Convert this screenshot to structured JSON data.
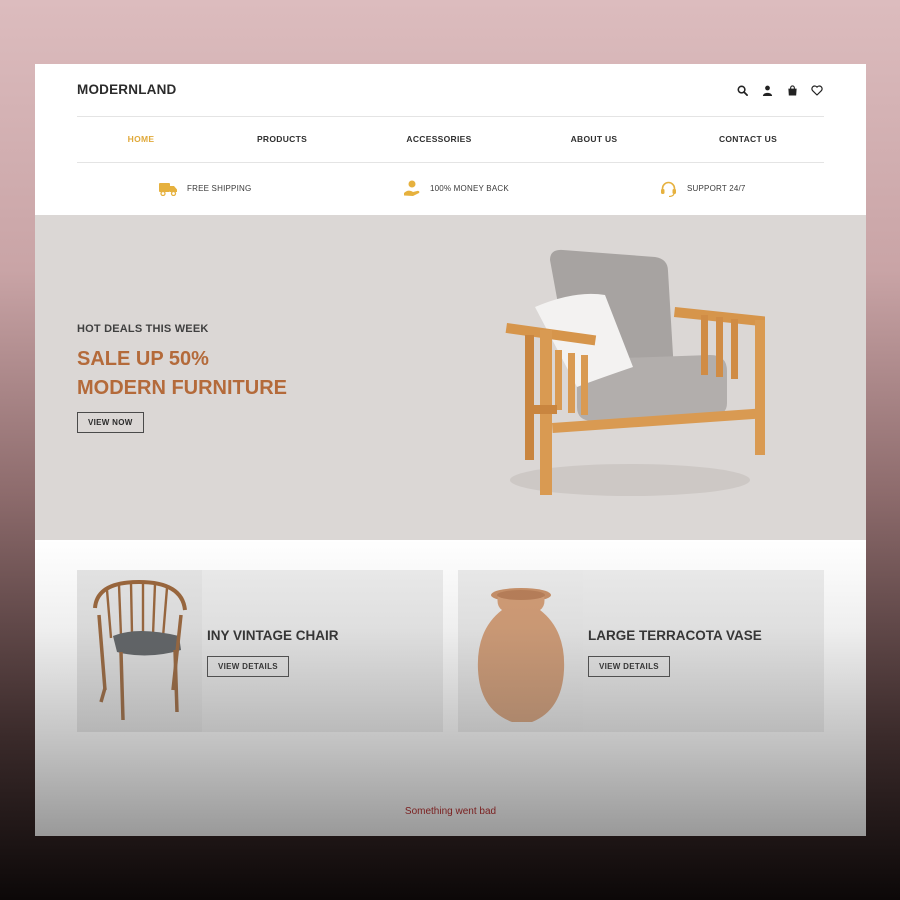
{
  "brand": {
    "name": "MODERNLAND"
  },
  "header_icons": [
    "search-icon",
    "user-icon",
    "bag-icon",
    "heart-icon"
  ],
  "nav": {
    "items": [
      {
        "label": "HOME",
        "active": true
      },
      {
        "label": "PRODUCTS",
        "active": false
      },
      {
        "label": "ACCESSORIES",
        "active": false
      },
      {
        "label": "ABOUT US",
        "active": false
      },
      {
        "label": "CONTACT US",
        "active": false
      }
    ]
  },
  "features": [
    {
      "icon": "truck-icon",
      "label": "FREE SHIPPING"
    },
    {
      "icon": "money-hand-icon",
      "label": "100% MONEY BACK"
    },
    {
      "icon": "headset-icon",
      "label": "SUPPORT 24/7"
    }
  ],
  "hero": {
    "eyebrow": "HOT DEALS THIS WEEK",
    "headline_line1": "SALE UP 50%",
    "headline_line2": "MODERN FURNITURE",
    "cta": "VIEW NOW"
  },
  "products": [
    {
      "title": "INY VINTAGE CHAIR",
      "cta": "VIEW DETAILS"
    },
    {
      "title": "LARGE TERRACOTA VASE",
      "cta": "VIEW DETAILS"
    }
  ],
  "status": {
    "error": "Something went bad"
  },
  "colors": {
    "accent": "#e0a93a",
    "headline": "#b46a3a",
    "hero_bg": "#dbd7d5",
    "error": "#7a1f1f"
  }
}
